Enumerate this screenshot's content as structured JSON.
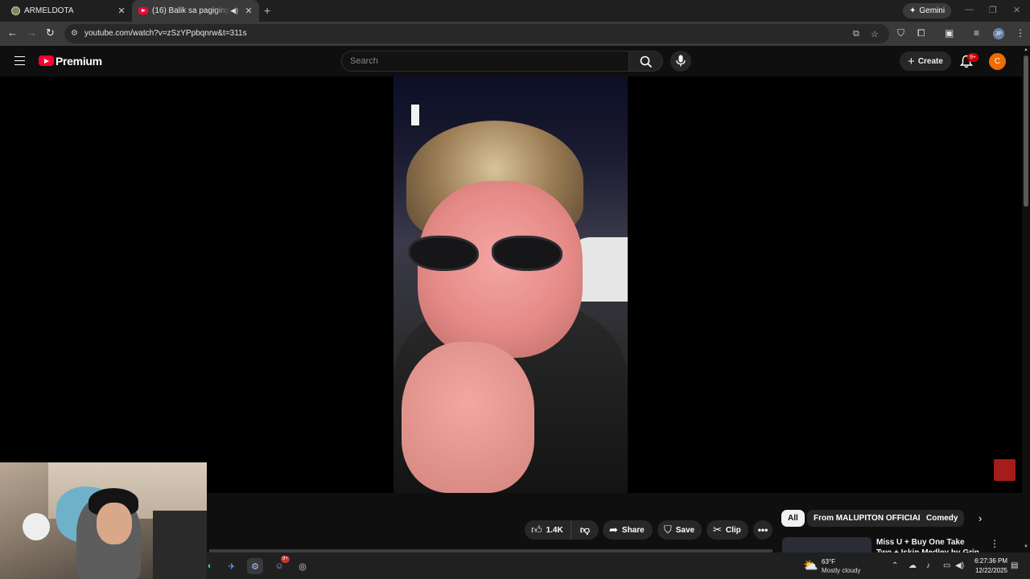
{
  "browser": {
    "tabs": [
      {
        "title": "ARMELDOTA",
        "active": false
      },
      {
        "title": "(16) Balik sa pagiging gag",
        "active": true
      }
    ],
    "gemini_label": "Gemini",
    "url": "youtube.com/watch?v=zSzYPpbqnrw&t=311s",
    "profile_initials": "JP"
  },
  "youtube": {
    "brand": "Premium",
    "search_placeholder": "Search",
    "create_label": "Create",
    "notification_badge": "9+",
    "avatar_letter": "C",
    "actions": {
      "likes": "1.4K",
      "share": "Share",
      "save": "Save",
      "clip": "Clip"
    },
    "chips": [
      "All",
      "From MALUPITON OFFICIAL",
      "Comedy"
    ],
    "recommendation": {
      "title": "Miss U + Buy One Take Two + Iskin Medley by Grin"
    }
  },
  "taskbar": {
    "discord_badge": "9+",
    "weather_temp": "63°F",
    "weather_desc": "Mostly cloudy",
    "time": "6:27:36 PM",
    "date": "12/22/2025"
  },
  "colors": {
    "yt_red": "#ff0033",
    "avatar": "#ef6c00",
    "background": "#0f0f0f"
  }
}
